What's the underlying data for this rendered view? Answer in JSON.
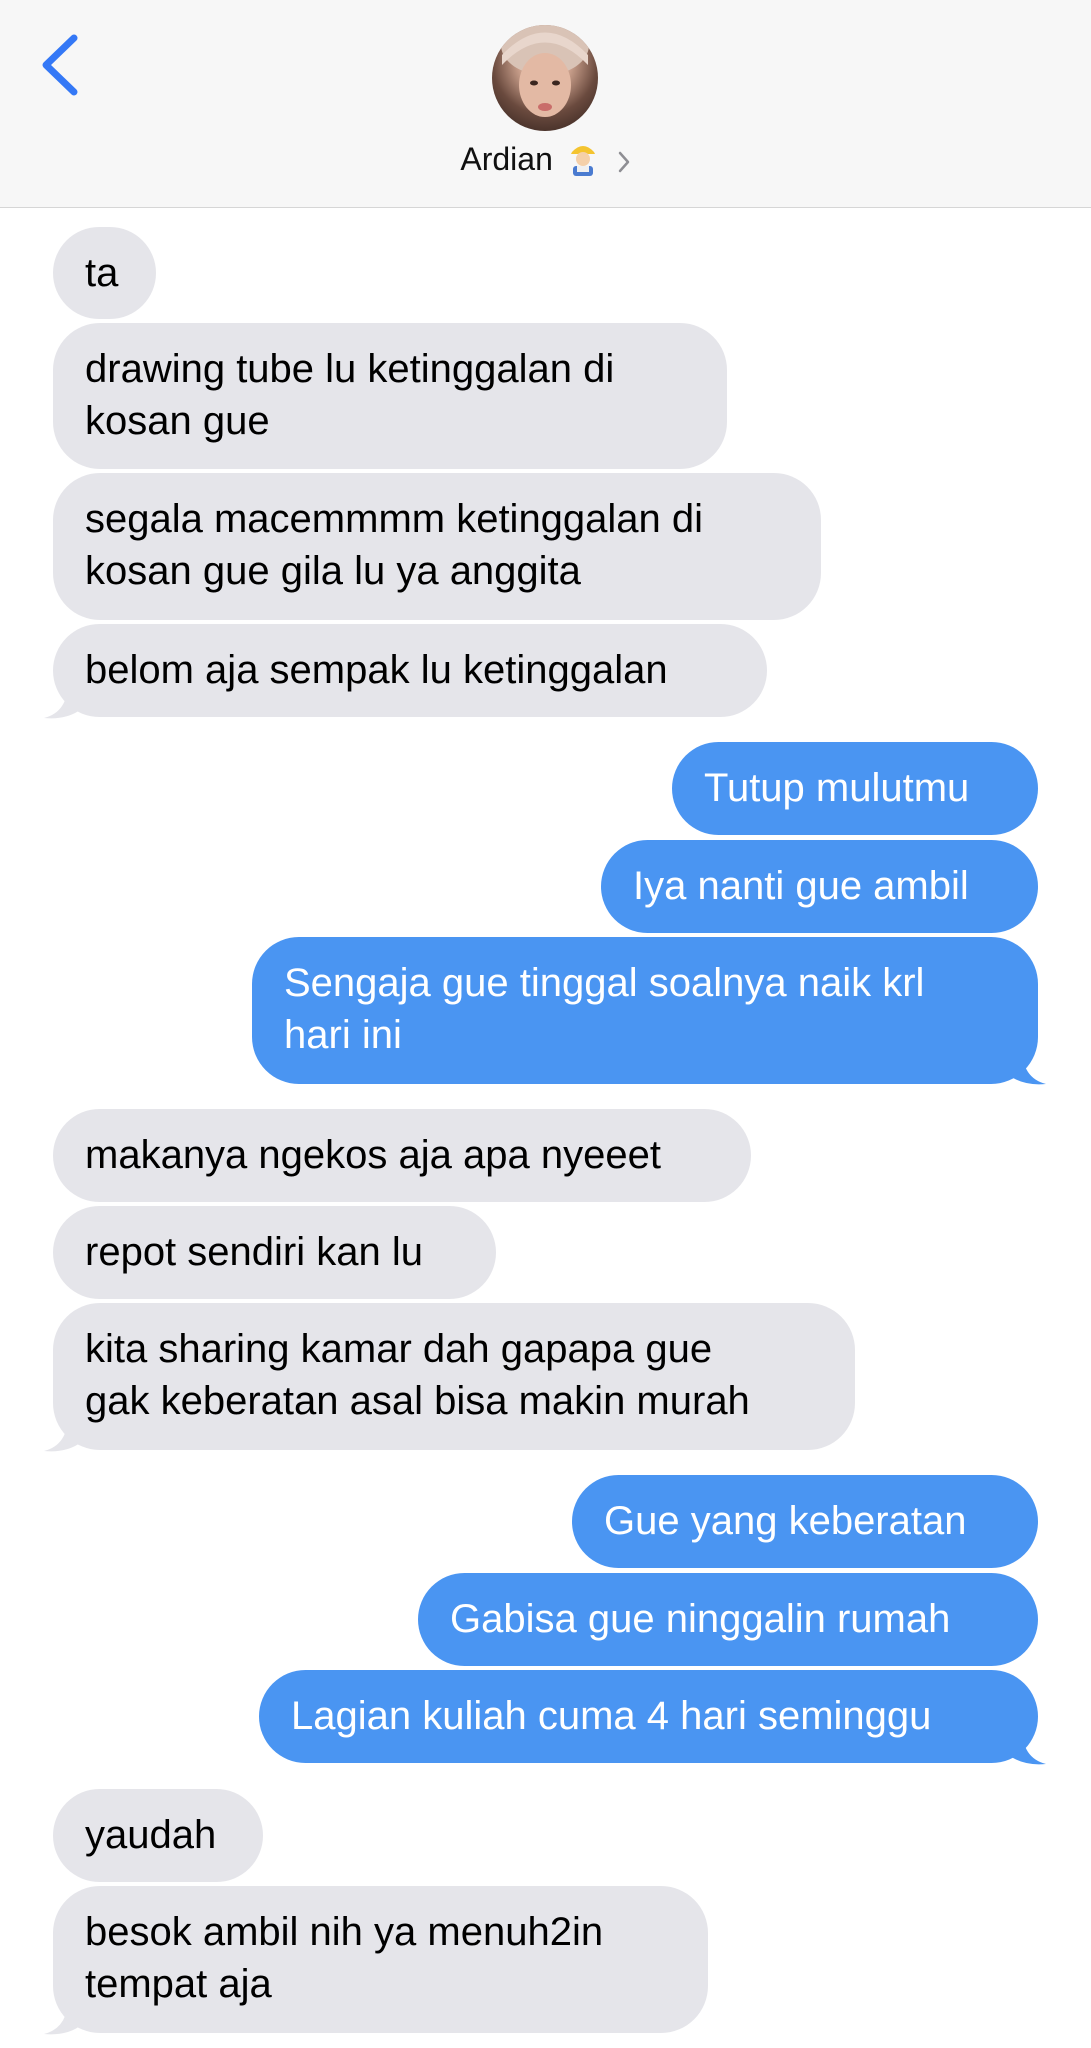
{
  "header": {
    "contact_name": "Ardian",
    "back_icon": "chevron-left-icon",
    "avatar": "contact-avatar",
    "emoji": "construction-worker-emoji",
    "disclosure_icon": "chevron-right-icon",
    "accent_color": "#3478f6"
  },
  "messages": [
    {
      "dir": "in",
      "text": "ta"
    },
    {
      "dir": "in",
      "text": "drawing tube lu ketinggalan di\nkosan gue"
    },
    {
      "dir": "in",
      "text": "segala macemmmm ketinggalan di\nkosan gue gila lu ya anggita"
    },
    {
      "dir": "in",
      "text": "belom aja sempak lu ketinggalan"
    },
    {
      "dir": "out",
      "text": "Tutup mulutmu"
    },
    {
      "dir": "out",
      "text": "Iya nanti gue ambil"
    },
    {
      "dir": "out",
      "text": "Sengaja gue tinggal soalnya naik krl\nhari ini"
    },
    {
      "dir": "in",
      "text": "makanya ngekos aja apa nyeeet"
    },
    {
      "dir": "in",
      "text": "repot sendiri kan lu"
    },
    {
      "dir": "in",
      "text": "kita sharing kamar dah gapapa gue\ngak keberatan asal bisa makin murah"
    },
    {
      "dir": "out",
      "text": "Gue yang keberatan"
    },
    {
      "dir": "out",
      "text": "Gabisa gue ninggalin rumah"
    },
    {
      "dir": "out",
      "text": "Lagian kuliah cuma 4 hari seminggu"
    },
    {
      "dir": "in",
      "text": "yaudah"
    },
    {
      "dir": "in",
      "text": "besok ambil nih ya menuh2in\ntempat aja"
    }
  ],
  "colors": {
    "incoming_bubble": "#e5e5ea",
    "outgoing_bubble": "#4a95f2",
    "outgoing_text": "#ffffff",
    "incoming_text": "#000000"
  }
}
